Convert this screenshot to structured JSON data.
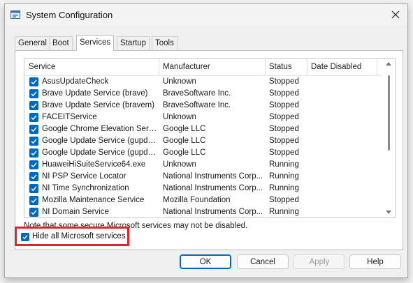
{
  "window": {
    "title": "System Configuration",
    "close_icon": "close-icon",
    "app_icon": "system-configuration-icon"
  },
  "tabs": [
    {
      "label": "General",
      "active": false
    },
    {
      "label": "Boot",
      "active": false
    },
    {
      "label": "Services",
      "active": true
    },
    {
      "label": "Startup",
      "active": false
    },
    {
      "label": "Tools",
      "active": false
    }
  ],
  "services": {
    "columns": [
      "Service",
      "Manufacturer",
      "Status",
      "Date Disabled"
    ],
    "rows": [
      {
        "checked": true,
        "name": "AsusUpdateCheck",
        "manufacturer": "Unknown",
        "status": "Stopped"
      },
      {
        "checked": true,
        "name": "Brave Update Service (brave)",
        "manufacturer": "BraveSoftware Inc.",
        "status": "Stopped"
      },
      {
        "checked": true,
        "name": "Brave Update Service (bravem)",
        "manufacturer": "BraveSoftware Inc.",
        "status": "Stopped"
      },
      {
        "checked": true,
        "name": "FACEITService",
        "manufacturer": "Unknown",
        "status": "Stopped"
      },
      {
        "checked": true,
        "name": "Google Chrome Elevation Servic...",
        "manufacturer": "Google LLC",
        "status": "Stopped"
      },
      {
        "checked": true,
        "name": "Google Update Service (gupdate)",
        "manufacturer": "Google LLC",
        "status": "Stopped"
      },
      {
        "checked": true,
        "name": "Google Update Service (gupdatem)",
        "manufacturer": "Google LLC",
        "status": "Stopped"
      },
      {
        "checked": true,
        "name": "HuaweiHiSuiteService64.exe",
        "manufacturer": "Unknown",
        "status": "Running"
      },
      {
        "checked": true,
        "name": "NI PSP Service Locator",
        "manufacturer": "National Instruments Corp...",
        "status": "Running"
      },
      {
        "checked": true,
        "name": "NI Time Synchronization",
        "manufacturer": "National Instruments Corp...",
        "status": "Running"
      },
      {
        "checked": true,
        "name": "Mozilla Maintenance Service",
        "manufacturer": "Mozilla Foundation",
        "status": "Stopped"
      },
      {
        "checked": true,
        "name": "NI Domain Service",
        "manufacturer": "National Instruments Corp...",
        "status": "Running"
      }
    ]
  },
  "note": "Note that some secure Microsoft services may not be disabled.",
  "hide_ms": {
    "label": "Hide all Microsoft services",
    "checked": true
  },
  "buttons": {
    "ok": "OK",
    "cancel": "Cancel",
    "apply": "Apply",
    "help": "Help"
  },
  "colors": {
    "accent": "#0067c0",
    "highlight_border": "#e3242b"
  }
}
